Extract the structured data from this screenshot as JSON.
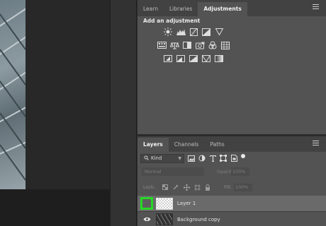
{
  "adjustments_panel": {
    "tabs": [
      {
        "label": "Learn",
        "active": false
      },
      {
        "label": "Libraries",
        "active": false
      },
      {
        "label": "Adjustments",
        "active": true
      }
    ],
    "title": "Add an adjustment",
    "row1_icons": [
      "brightness-contrast-icon",
      "levels-icon",
      "curves-icon",
      "exposure-icon",
      "vibrance-icon"
    ],
    "row2_icons": [
      "hue-saturation-icon",
      "color-balance-icon",
      "black-white-icon",
      "photo-filter-icon",
      "channel-mixer-icon",
      "color-lookup-icon"
    ],
    "row3_icons": [
      "invert-icon",
      "posterize-icon",
      "threshold-icon",
      "selective-color-icon",
      "gradient-map-icon"
    ]
  },
  "layers_panel": {
    "tabs": [
      {
        "label": "Layers",
        "active": true
      },
      {
        "label": "Channels",
        "active": false
      },
      {
        "label": "Paths",
        "active": false
      }
    ],
    "filter_kind": "Kind",
    "blend_mode": "Normal",
    "opacity_label": "Opacity:",
    "opacity_value": "100%",
    "lock_label": "Lock:",
    "fill_label": "Fill:",
    "fill_value": "100%",
    "layers": [
      {
        "name": "Layer 1",
        "selected": true,
        "visible": false
      },
      {
        "name": "Background copy",
        "selected": false,
        "visible": true
      }
    ]
  },
  "colors": {
    "highlight_green": "#26d926",
    "panel_bg": "#535353"
  }
}
